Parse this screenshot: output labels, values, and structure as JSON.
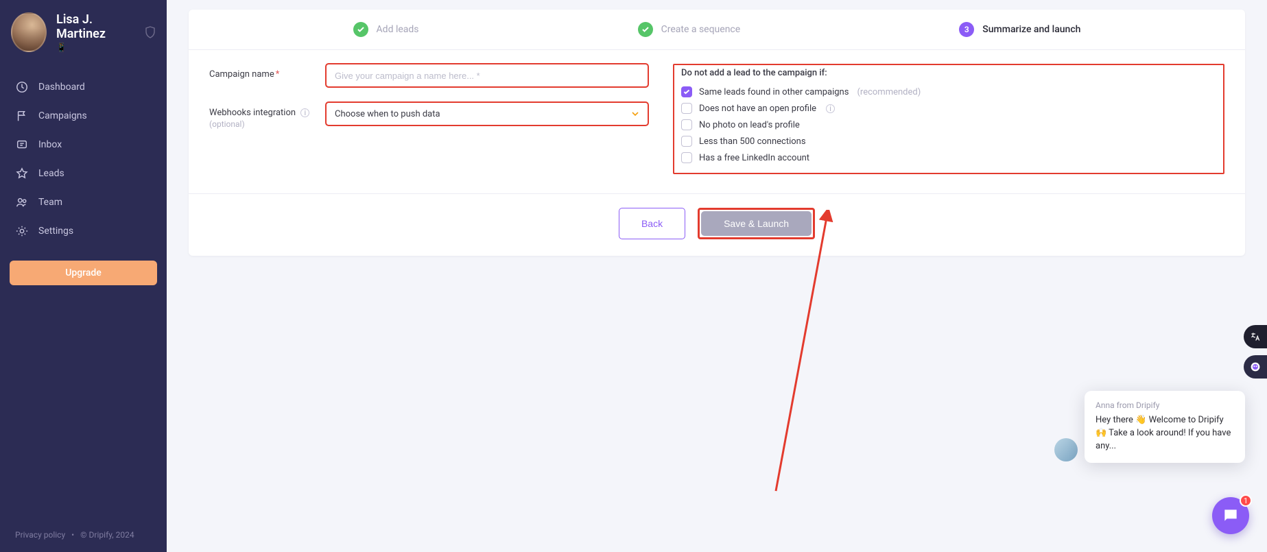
{
  "user": {
    "name": "Lisa J. Martinez",
    "sub": "📱"
  },
  "nav": {
    "dashboard": "Dashboard",
    "campaigns": "Campaigns",
    "inbox": "Inbox",
    "leads": "Leads",
    "team": "Team",
    "settings": "Settings",
    "upgrade": "Upgrade"
  },
  "footer": {
    "privacy": "Privacy policy",
    "copyright": "© Dripify, 2024"
  },
  "steps": {
    "s1": "Add leads",
    "s2": "Create a sequence",
    "s3_num": "3",
    "s3": "Summarize and launch"
  },
  "form": {
    "campaign_label": "Campaign name",
    "campaign_placeholder": "Give your campaign a name here... *",
    "webhooks_label": "Webhooks integration",
    "webhooks_opt": "(optional)",
    "webhooks_value": "Choose when to push data"
  },
  "filters": {
    "heading": "Do not add a lead to the campaign if:",
    "f1": "Same leads found in other campaigns",
    "f1_reco": "(recommended)",
    "f2": "Does not have an open profile",
    "f3": "No photo on lead's profile",
    "f4": "Less than 500 connections",
    "f5": "Has a free LinkedIn account"
  },
  "actions": {
    "back": "Back",
    "launch": "Save & Launch"
  },
  "chat": {
    "from": "Anna from Dripify",
    "msg": "Hey there 👋 Welcome to Dripify 🙌 Take a look around! If you have any...",
    "badge": "1"
  }
}
